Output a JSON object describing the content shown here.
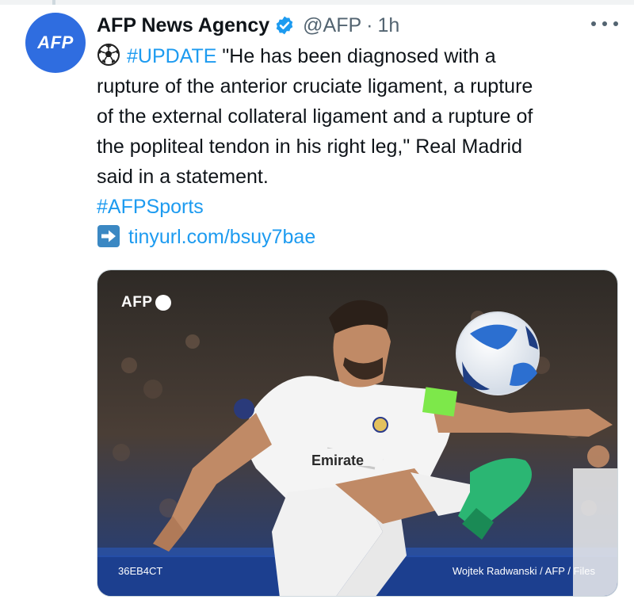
{
  "author": {
    "avatar_text": "AFP",
    "display_name": "AFP News Agency",
    "handle": "@AFP",
    "separator": "·",
    "time": "1h",
    "verified": true
  },
  "tweet": {
    "lines": [
      {
        "hashtag": "#UPDATE",
        "text": " \"He has been diagnosed with a"
      },
      {
        "text": "rupture of the anterior cruciate ligament, a rupture"
      },
      {
        "text": "of the external collateral ligament and a rupture of"
      },
      {
        "text": "the popliteal tendon in his right leg,\" Real Madrid"
      },
      {
        "text": "said in a statement."
      }
    ],
    "hashtag_sports": "#AFPSports",
    "link": "tinyurl.com/bsuy7bae"
  },
  "media": {
    "watermark": "AFP",
    "photo_id": "36EB4CT",
    "credit": "Wojtek Radwanski / AFP / Files",
    "shirt_sponsor": "Emirate"
  },
  "colors": {
    "link": "#1d9bf0",
    "avatar": "#2f6de0",
    "verified": "#1d9bf0",
    "text": "#0f1419",
    "secondary": "#536471"
  },
  "icons": {
    "verified": "verified-badge-icon",
    "more": "more-dots-icon",
    "ball": "soccer-ball-icon",
    "arrow": "right-arrow-icon"
  }
}
